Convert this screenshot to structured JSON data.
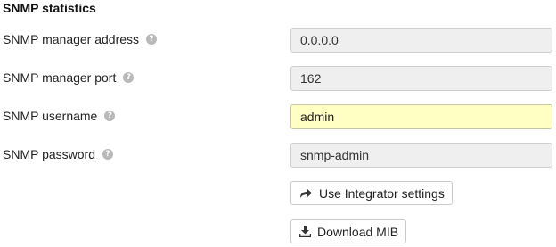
{
  "section": {
    "title": "SNMP statistics"
  },
  "fields": [
    {
      "label": "SNMP manager address",
      "value": "0.0.0.0"
    },
    {
      "label": "SNMP manager port",
      "value": "162"
    },
    {
      "label": "SNMP username",
      "value": "admin"
    },
    {
      "label": "SNMP password",
      "value": "snmp-admin"
    }
  ],
  "help_icon": {
    "name": "question-circle-icon",
    "glyph": "?"
  },
  "buttons": {
    "integrator": {
      "label": "Use Integrator settings",
      "icon": "share-arrow-icon"
    },
    "download_mib": {
      "label": "Download MIB",
      "icon": "download-icon"
    }
  },
  "colors": {
    "field_bg": "#efefef",
    "field_active_bg": "#ffffc4",
    "help_icon": "#b9b9b9"
  }
}
